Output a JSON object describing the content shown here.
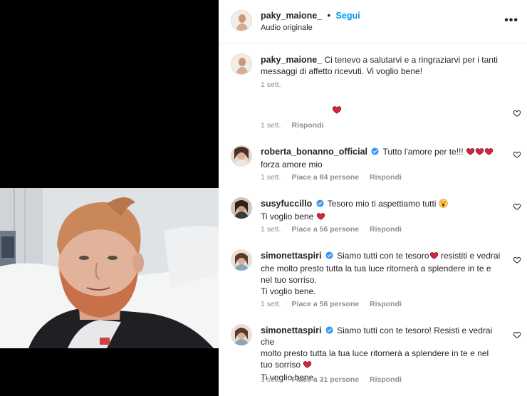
{
  "header": {
    "username": "paky_maione_",
    "separator": "•",
    "follow_label": "Segui",
    "subtitle": "Audio originale",
    "more_icon": "more-horizontal-icon"
  },
  "comments": [
    {
      "username": "paky_maione_",
      "text_line1": "Ci tenevo a salutarvi e a ringraziarvi per i tanti",
      "text_line2": "messaggi di affetto ricevuti. Vi voglio bene!",
      "time": "1 sett."
    },
    {
      "emoji": "heart",
      "time": "1 sett.",
      "reply": "Rispondi"
    },
    {
      "username": "roberta_bonanno_official",
      "text": "Tutto l'amore per te!!!",
      "text_line2": "forza amore mio",
      "time": "1 sett.",
      "likes": "Piace a 84 persone",
      "reply": "Rispondi"
    },
    {
      "username": "susyfuccillo",
      "text": "Tesoro mio ti aspettiamo tutti",
      "text_line2": "Ti voglio bene",
      "time": "1 sett.",
      "likes": "Piace a 56 persone",
      "reply": "Rispondi"
    },
    {
      "username": "simonettaspiri",
      "text": "Siamo tutti con te tesoro",
      "text_tail": "resistiti e vedrai",
      "text_line2": "che molto presto tutta la tua luce ritornerà a splendere in te e",
      "text_line3": "nel tuo sorriso.",
      "text_line4": "Ti voglio bene.",
      "time": "1 sett.",
      "likes": "Piace a 56 persone",
      "reply": "Rispondi"
    },
    {
      "username": "simonettaspiri",
      "text": "Siamo tutti con te tesoro! Resisti e vedrai che",
      "text_line2": "molto presto tutta la tua luce ritornerà a splendere in te e nel",
      "text_line3": "tuo sorriso",
      "text_line4": "Ti voglio bene.",
      "time": "1 sett.",
      "likes": "Piace a 31 persone",
      "reply": "Rispondi"
    }
  ],
  "colors": {
    "accent": "#0095f6",
    "heart": "#e0245e",
    "verified": "#3897f0",
    "muted": "#8e8e8e"
  }
}
